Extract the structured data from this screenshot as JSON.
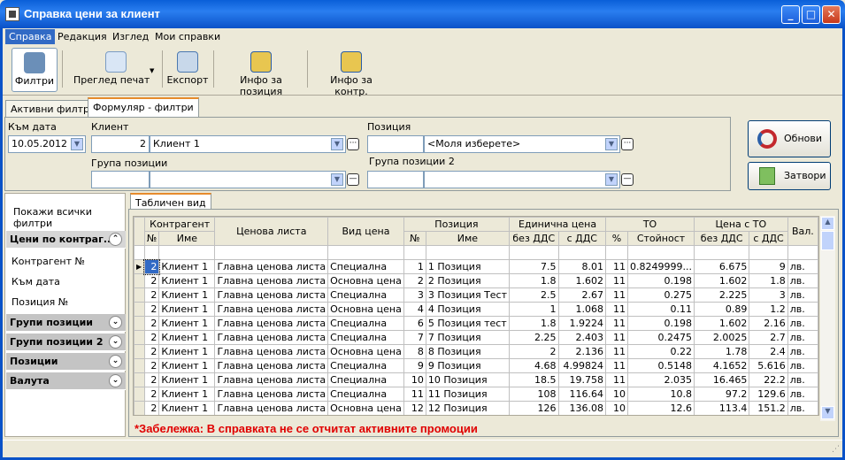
{
  "window": {
    "title": "Справка цени за клиент",
    "icon": "report-icon"
  },
  "menu": [
    "Справка",
    "Редакция",
    "Изглед",
    "Мои справки"
  ],
  "toolbar": {
    "filters": "Филтри",
    "print_preview": "Преглед печат",
    "export": "Експорт",
    "position_info": "Инфо за позиция",
    "contract_info": "Инфо за контр."
  },
  "tabs": {
    "active_filters": "Активни филтри",
    "form_filters": "Формуляр - филтри",
    "table_view": "Табличен вид"
  },
  "filters": {
    "to_date_label": "Към дата",
    "to_date_value": "10.05.2012",
    "client_label": "Клиент",
    "client_id": "2",
    "client_name": "Клиент 1",
    "position_label": "Позиция",
    "position_placeholder": "<Моля изберете>",
    "position_group_label": "Група позиции",
    "position_group2_label": "Група позиции 2"
  },
  "buttons": {
    "refresh": "Обнови",
    "close": "Затвори"
  },
  "left": {
    "show_all": "Покажи всички филтри",
    "groups": [
      "Цени по контраг...",
      "Групи позиции",
      "Групи позиции 2",
      "Позиции",
      "Валута"
    ],
    "items": [
      "Контрагент №",
      "Към дата",
      "Позиция №"
    ]
  },
  "grid": {
    "h1": {
      "counterparty": "Контрагент",
      "price_list": "Ценова листа",
      "price_type": "Вид цена",
      "position": "Позиция",
      "unit_price": "Единична цена",
      "to": "ТО",
      "price_to": "Цена с ТО",
      "currency": "Вал."
    },
    "h2": {
      "no": "№",
      "name": "Име",
      "pno": "№",
      "pname": "Име",
      "no_vat": "без ДДС",
      "with_vat": "с ДДС",
      "pct": "%",
      "value": "Стойност",
      "no_vat2": "без ДДС",
      "with_vat2": "с ДДС"
    },
    "rows": [
      [
        "2",
        "Клиент 1",
        "Главна ценова листа",
        "Специална",
        "1",
        "1 Позиция",
        "7.5",
        "8.01",
        "11",
        "0.8249999...",
        "6.675",
        "9",
        "лв."
      ],
      [
        "2",
        "Клиент 1",
        "Главна ценова листа",
        "Основна цена",
        "2",
        "2 Позиция",
        "1.8",
        "1.602",
        "11",
        "0.198",
        "1.602",
        "1.8",
        "лв."
      ],
      [
        "2",
        "Клиент 1",
        "Главна ценова листа",
        "Специална",
        "3",
        "3 Позиция Тест",
        "2.5",
        "2.67",
        "11",
        "0.275",
        "2.225",
        "3",
        "лв."
      ],
      [
        "2",
        "Клиент 1",
        "Главна ценова листа",
        "Основна цена",
        "4",
        "4 Позиция",
        "1",
        "1.068",
        "11",
        "0.11",
        "0.89",
        "1.2",
        "лв."
      ],
      [
        "2",
        "Клиент 1",
        "Главна ценова листа",
        "Специална",
        "6",
        "5 Позиция тест",
        "1.8",
        "1.9224",
        "11",
        "0.198",
        "1.602",
        "2.16",
        "лв."
      ],
      [
        "2",
        "Клиент 1",
        "Главна ценова листа",
        "Специална",
        "7",
        "7 Позиция",
        "2.25",
        "2.403",
        "11",
        "0.2475",
        "2.0025",
        "2.7",
        "лв."
      ],
      [
        "2",
        "Клиент 1",
        "Главна ценова листа",
        "Основна цена",
        "8",
        "8 Позиция",
        "2",
        "2.136",
        "11",
        "0.22",
        "1.78",
        "2.4",
        "лв."
      ],
      [
        "2",
        "Клиент 1",
        "Главна ценова листа",
        "Специална",
        "9",
        "9 Позиция",
        "4.68",
        "4.99824",
        "11",
        "0.5148",
        "4.1652",
        "5.616",
        "лв."
      ],
      [
        "2",
        "Клиент 1",
        "Главна ценова листа",
        "Специална",
        "10",
        "10 Позиция",
        "18.5",
        "19.758",
        "11",
        "2.035",
        "16.465",
        "22.2",
        "лв."
      ],
      [
        "2",
        "Клиент 1",
        "Главна ценова листа",
        "Специална",
        "11",
        "11 Позиция",
        "108",
        "116.64",
        "10",
        "10.8",
        "97.2",
        "129.6",
        "лв."
      ],
      [
        "2",
        "Клиент 1",
        "Главна ценова листа",
        "Основна цена",
        "12",
        "12 Позиция",
        "126",
        "136.08",
        "10",
        "12.6",
        "113.4",
        "151.2",
        "лв."
      ]
    ]
  },
  "note": "*Забележка: В справката не се отчитат активните промоции"
}
